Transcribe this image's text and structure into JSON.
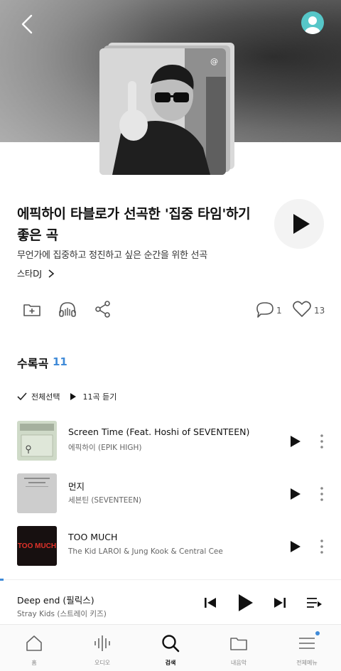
{
  "playlist": {
    "title": "에픽하이 타블로가 선곡한 '집중 타임'하기 좋은 곡",
    "subtitle": "무언가에 집중하고 정진하고 싶은 순간을 위한 선곡",
    "dj_link": "스타DJ",
    "cover_badge": "@"
  },
  "actions": {
    "comments_count": "1",
    "likes_count": "13"
  },
  "tracklist": {
    "section_title": "수록곡",
    "count": "11",
    "select_all_label": "전체선택",
    "play_all_label": "11곡 듣기",
    "tracks": [
      {
        "title": "Screen Time (Feat. Hoshi of SEVENTEEN)",
        "artist": "에픽하이 (EPIK HIGH)",
        "thumb": "light-green"
      },
      {
        "title": "먼지",
        "artist": "세븐틴 (SEVENTEEN)",
        "thumb": "gray"
      },
      {
        "title": "TOO MUCH",
        "artist": "The Kid LAROI & Jung Kook & Central Cee",
        "thumb": "dark-red",
        "thumb_text": "TOO MUCH"
      }
    ]
  },
  "now_playing": {
    "title": "Deep end (필릭스)",
    "artist": "Stray Kids (스트레이 키즈)",
    "progress": 0.01
  },
  "nav": {
    "items": [
      {
        "label": "홈",
        "icon": "home-icon"
      },
      {
        "label": "오디오",
        "icon": "audio-wave-icon"
      },
      {
        "label": "검색",
        "icon": "search-icon"
      },
      {
        "label": "내음악",
        "icon": "folder-icon"
      },
      {
        "label": "전체메뉴",
        "icon": "menu-icon"
      }
    ],
    "active_index": 2
  },
  "colors": {
    "accent": "#3f8ad8",
    "avatar": "#56c6c8"
  }
}
